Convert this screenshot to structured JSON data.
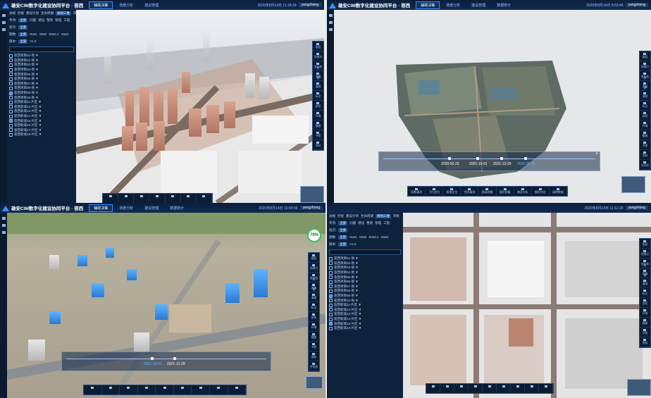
{
  "header": {
    "title": "雄安CIM数字化建设协同平台 · 容西",
    "tabs": [
      "辅助决策",
      "场景分析",
      "建设管理",
      "数据统计"
    ],
    "clocks": [
      "2020年8月14日 11:18:29",
      "2020年8月14日 8:53:49",
      "2020年8月14日 10:04:56",
      "2020年8月14日 11:12:20"
    ],
    "user": "yangzhong"
  },
  "panel": {
    "row1": [
      "总规",
      "控规",
      "建设计划",
      "生命周期",
      "规划三维",
      "审批"
    ],
    "row2_label": "专项:",
    "row2": [
      "全部",
      "问题",
      "建设",
      "整改",
      "管理",
      "工程"
    ],
    "row3_label": "批次:",
    "row3": [
      "全部"
    ],
    "row4_label": "期数:",
    "row4": [
      "全部",
      "Stat1",
      "Stat2",
      "Stat4.2",
      "Stat3"
    ],
    "row5_label": "版本:",
    "row5": [
      "全部",
      "V1.0"
    ],
    "tree": [
      {
        "label": "容西项目01-地 ▼",
        "on": false
      },
      {
        "label": "容西项目02-地 ▼",
        "on": false
      },
      {
        "label": "容西项目03-地 ▼",
        "on": false
      },
      {
        "label": "容西项目04-地 ▼",
        "on": false
      },
      {
        "label": "容西项目05-地 ▼",
        "on": false
      },
      {
        "label": "容西项目06-地 ▼",
        "on": false
      },
      {
        "label": "容西项目07-地 ▼",
        "on": false
      },
      {
        "label": "容西项目08-地 ▼",
        "on": false
      },
      {
        "label": "容西项目09-地 ▼",
        "on": true
      },
      {
        "label": "容西项目10-地 ▼",
        "on": false
      },
      {
        "label": "容西新城11-片区 ▼",
        "on": false
      },
      {
        "label": "容西新城12-片区 ▼",
        "on": false
      },
      {
        "label": "容西新城13-片区 ▼",
        "on": false
      },
      {
        "label": "容西新城14-片区 ▼",
        "on": false
      },
      {
        "label": "容西新城15-片区 ▼",
        "on": true
      },
      {
        "label": "容西新城16-片区 ▼",
        "on": false
      },
      {
        "label": "容西新城17-片区 ▼",
        "on": false
      },
      {
        "label": "容西新城18-片区 ▼",
        "on": false
      }
    ]
  },
  "right_tools": [
    "图层",
    "场景分析",
    "坐标拾取",
    "测量",
    "漫游",
    "标注",
    "剖切",
    "环境",
    "截图",
    "书签",
    "资料",
    "空间资源"
  ],
  "bottom_tools": [
    "场景漫游",
    "飞行定位",
    "视角定位",
    "空间量测",
    "视高测量",
    "面积测量",
    "淹没分析",
    "模型对比",
    "清除数据"
  ],
  "timeline_q2": {
    "dates": [
      "2020-02-29",
      "2021-10-01",
      "2021-12-29",
      "2022-05-16"
    ],
    "active": 3
  },
  "timeline_q3": {
    "dates": [
      "2021-10-01",
      "2021-12-29"
    ]
  },
  "compass_value": "79%",
  "mini_label": "底图"
}
